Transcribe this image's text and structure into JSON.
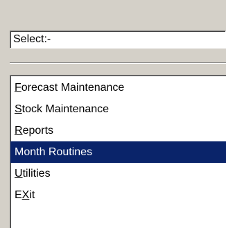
{
  "select": {
    "value": "Select:-"
  },
  "menu": {
    "items": [
      {
        "accel": "F",
        "rest": "orecast Maintenance",
        "pre": "",
        "selected": false
      },
      {
        "accel": "S",
        "rest": "tock Maintenance",
        "pre": "",
        "selected": false
      },
      {
        "accel": "R",
        "rest": "eports",
        "pre": "",
        "selected": false
      },
      {
        "label": "Month Routines",
        "selected": true
      },
      {
        "accel": "U",
        "rest": "tilities",
        "pre": "",
        "selected": false
      },
      {
        "pre": "E",
        "accel": "X",
        "rest": "it",
        "selected": false
      }
    ]
  },
  "colors": {
    "window_bg": "#d4d0c8",
    "selection_bg": "#0a246a",
    "selection_text": "#ffffff"
  }
}
